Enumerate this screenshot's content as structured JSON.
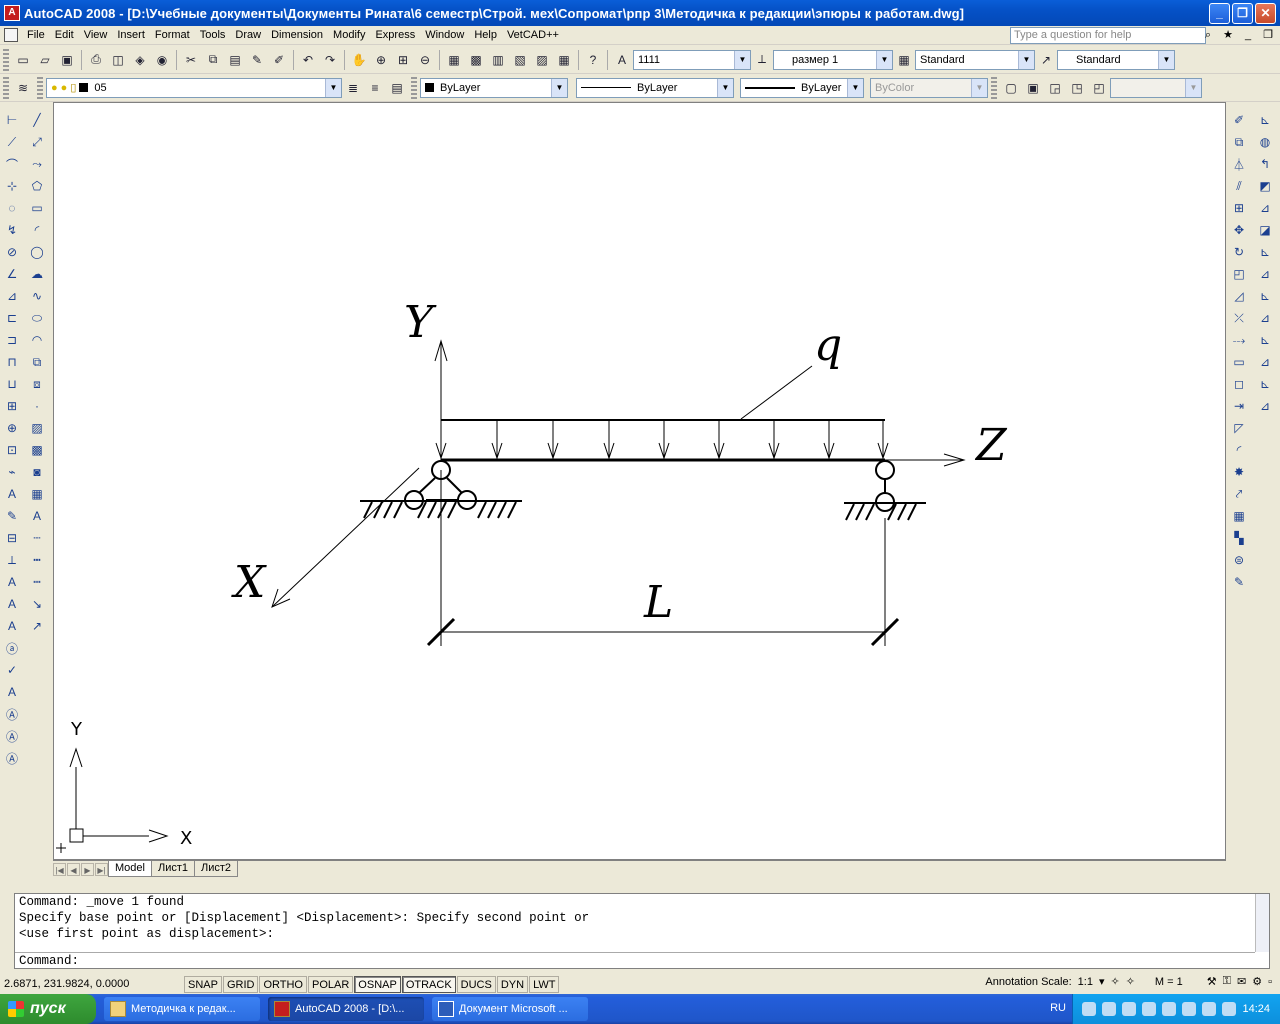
{
  "window": {
    "title": "AutoCAD 2008 - [D:\\Учебные документы\\Документы Рината\\6 семестр\\Строй. мех\\Сопромат\\рпр 3\\Методичка к редакции\\эпюры к работам.dwg]",
    "min": "_",
    "restore": "❐",
    "close": "✕"
  },
  "menu": {
    "items": [
      "File",
      "Edit",
      "View",
      "Insert",
      "Format",
      "Tools",
      "Draw",
      "Dimension",
      "Modify",
      "Express",
      "Window",
      "Help",
      "VetCAD++"
    ],
    "help_placeholder": "Type a question for help"
  },
  "toolbar1": {
    "text_style_value": "1111",
    "dim_style_value": "размер 1",
    "table_style_value": "Standard",
    "multileader_style_value": "Standard"
  },
  "toolbar2": {
    "layer_value": "05",
    "color_value": "ByLayer",
    "linetype_value": "ByLayer",
    "lineweight_value": "ByLayer",
    "plotstyle_value": "ByColor"
  },
  "drawing": {
    "label_y": "Y",
    "label_z": "Z",
    "label_x": "X",
    "label_q": "q",
    "label_l": "L",
    "ucs_y": "Y",
    "ucs_x": "X"
  },
  "tabs": {
    "model": "Model",
    "sheet1": "Лист1",
    "sheet2": "Лист2"
  },
  "command": {
    "lines": [
      "Command: _move 1 found",
      "Specify base point or [Displacement] <Displacement>: Specify second point or",
      "<use first point as displacement>:"
    ],
    "prompt": "Command:"
  },
  "status": {
    "coords": "2.6871, 231.9824, 0.0000",
    "modes": [
      {
        "label": "SNAP",
        "on": false
      },
      {
        "label": "GRID",
        "on": false
      },
      {
        "label": "ORTHO",
        "on": false
      },
      {
        "label": "POLAR",
        "on": false
      },
      {
        "label": "OSNAP",
        "on": true
      },
      {
        "label": "OTRACK",
        "on": true
      },
      {
        "label": "DUCS",
        "on": false
      },
      {
        "label": "DYN",
        "on": false
      },
      {
        "label": "LWT",
        "on": false
      }
    ],
    "annotation_label": "Annotation Scale:",
    "annotation_value": "1:1",
    "scale_m": "M = 1"
  },
  "taskbar": {
    "start": "пуск",
    "tasks": [
      "Методичка к редак...",
      "AutoCAD 2008 - [D:\\...",
      "Документ Microsoft ..."
    ],
    "lang": "RU",
    "time": "14:24"
  }
}
